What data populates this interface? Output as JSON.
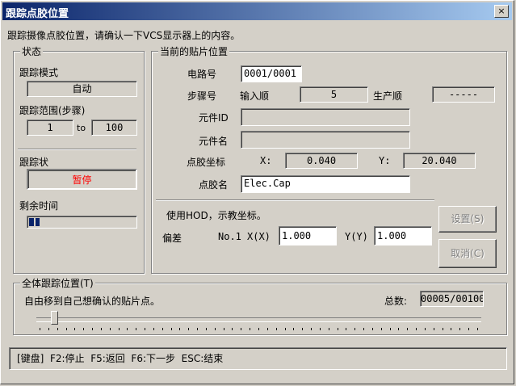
{
  "window": {
    "title": "跟踪点胶位置",
    "close_glyph": "×"
  },
  "header": {
    "instruction": "跟踪摄像点胶位置，请确认一下VCS显示器上的内容。"
  },
  "status": {
    "legend": "状态",
    "mode_label": "跟踪模式",
    "mode_value": "自动",
    "range_label": "跟踪范围(步骤)",
    "range_from": "1",
    "range_to_label": "to",
    "range_to": "100",
    "state_label": "跟踪状",
    "state_value": "暂停",
    "state_color": "#ff0000",
    "remaining_label": "剩余时间",
    "remaining_progress": 0.1
  },
  "current": {
    "legend": "当前的贴片位置",
    "circuit_label": "电路号",
    "circuit_value": "0001/0001",
    "step_label": "步骤号",
    "input_order_label": "输入顺",
    "input_order_value": "5",
    "production_order_label": "生产顺",
    "production_order_value": "-----",
    "part_id_label": "元件ID",
    "part_id_value": "",
    "part_name_label": "元件名",
    "part_name_value": "",
    "coord_label": "点胶坐标",
    "x_label": "X:",
    "x_value": "0.040",
    "y_label": "Y:",
    "y_value": "20.040",
    "dispense_name_label": "点胶名",
    "dispense_name_value": "Elec.Cap",
    "hod_text": "使用HOD，示教坐标。",
    "offset_label": "偏差",
    "no_label": "No.1",
    "x_input_label": "X(X)",
    "x_input_value": "1.000",
    "y_input_label": "Y(Y)",
    "y_input_value": "1.000",
    "set_button": "设置(S)",
    "cancel_button": "取消(C)"
  },
  "overall": {
    "legend": "全体跟踪位置(T)",
    "hint": "自由移到自己想确认的贴片点。",
    "total_label": "总数:",
    "total_value": "00005/00100",
    "slider_position": 0.04
  },
  "keyboard": {
    "text": "[键盘]  F2:停止  F5:返回  F6:下一步  ESC:结束"
  }
}
